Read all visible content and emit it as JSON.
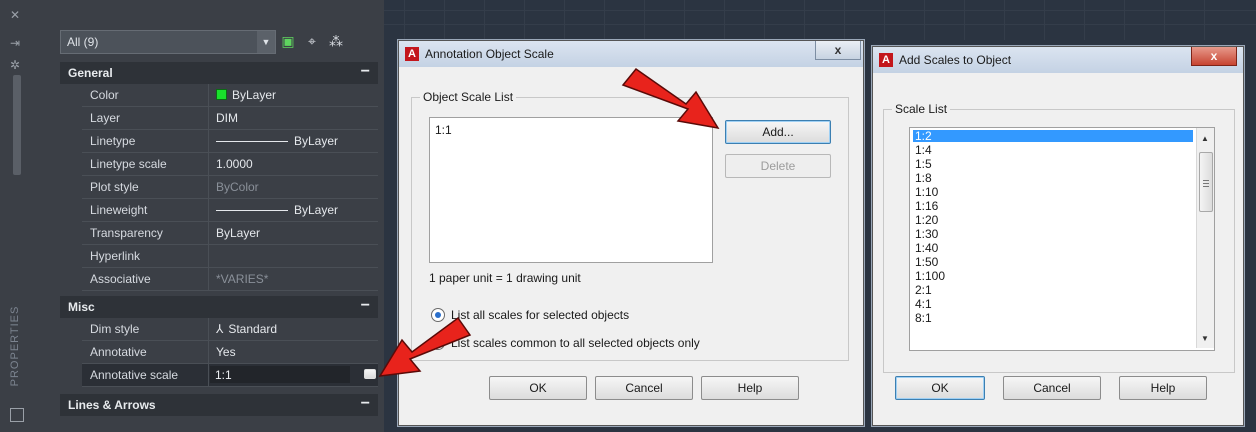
{
  "strip": {
    "title": "PROPERTIES"
  },
  "palette": {
    "combo_value": "All (9)",
    "sections": {
      "general": "General",
      "misc": "Misc",
      "lines": "Lines & Arrows"
    },
    "general_rows": [
      {
        "label": "Color",
        "value": "ByLayer"
      },
      {
        "label": "Layer",
        "value": "DIM"
      },
      {
        "label": "Linetype",
        "value": "ByLayer"
      },
      {
        "label": "Linetype scale",
        "value": "1.0000"
      },
      {
        "label": "Plot style",
        "value": "ByColor"
      },
      {
        "label": "Lineweight",
        "value": "ByLayer"
      },
      {
        "label": "Transparency",
        "value": "ByLayer"
      },
      {
        "label": "Hyperlink",
        "value": ""
      },
      {
        "label": "Associative",
        "value": "*VARIES*"
      }
    ],
    "misc_rows": [
      {
        "label": "Dim style",
        "value": "Standard"
      },
      {
        "label": "Annotative",
        "value": "Yes"
      },
      {
        "label": "Annotative scale",
        "value": "1:1"
      }
    ],
    "color_swatch": "#19e02c"
  },
  "annotation_dialog": {
    "title": "Annotation Object Scale",
    "close": "x",
    "group_label": "Object Scale List",
    "list_items": [
      "1:1"
    ],
    "add_button": "Add...",
    "delete_button": "Delete",
    "unit_text": "1 paper unit = 1 drawing unit",
    "radio_all": "List all scales for selected objects",
    "radio_common": "List scales common to all selected objects only",
    "ok": "OK",
    "cancel": "Cancel",
    "help": "Help"
  },
  "add_dialog": {
    "title": "Add Scales to Object",
    "close": "x",
    "group_label": "Scale List",
    "scales": [
      "1:2",
      "1:4",
      "1:5",
      "1:8",
      "1:10",
      "1:16",
      "1:20",
      "1:30",
      "1:40",
      "1:50",
      "1:100",
      "2:1",
      "4:1",
      "8:1"
    ],
    "selected": "1:2",
    "ok": "OK",
    "cancel": "Cancel",
    "help": "Help"
  },
  "colors": {
    "accent_red": "#e8231c",
    "selection_blue": "#3399ff"
  }
}
